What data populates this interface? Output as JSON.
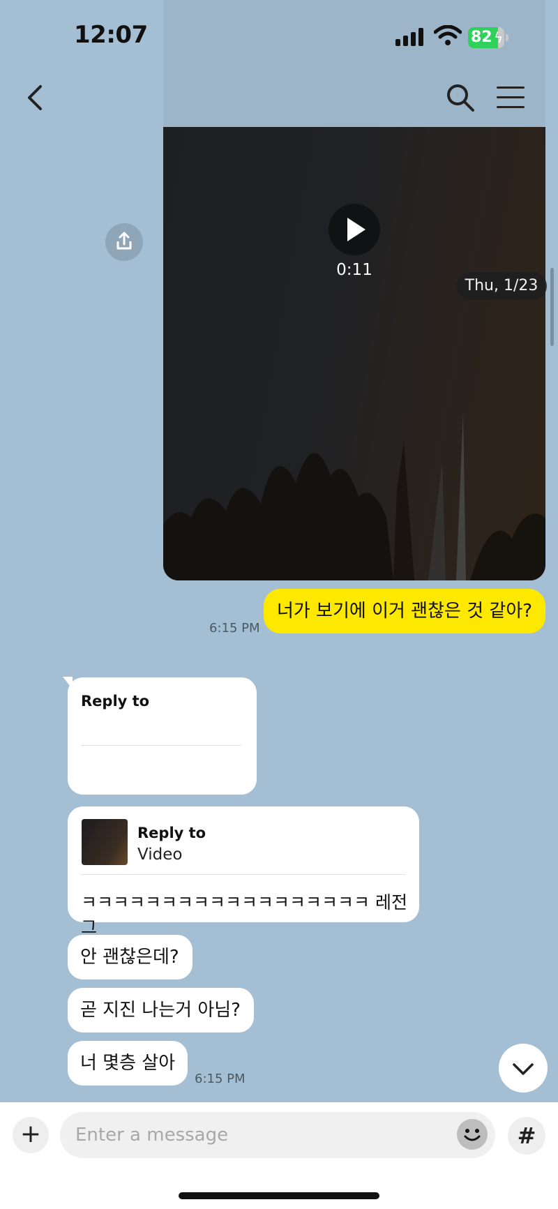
{
  "status_bar": {
    "time": "12:07",
    "battery_percent": "82",
    "battery_level": 0.82
  },
  "chat": {
    "video_message": {
      "duration": "0:11",
      "date_chip": "Thu, 1/23"
    },
    "outgoing": {
      "text": "너가 보기에 이거 괜찮은 것 같아?",
      "time": "6:15 PM"
    },
    "incoming": {
      "reply_card": {
        "label": "Reply to"
      },
      "video_reply": {
        "label": "Reply to",
        "subtitle": "Video",
        "text": "ㅋㅋㅋㅋㅋㅋㅋㅋㅋㅋㅋㅋㅋㅋㅋㅋㅋㅋ 레전그"
      },
      "messages": [
        {
          "text": "안 괜찮은데?"
        },
        {
          "text": "곧 지진 나는거 아님?"
        },
        {
          "text": "너 몇층 살아"
        }
      ],
      "time": "6:15 PM"
    }
  },
  "input_bar": {
    "placeholder": "Enter a message",
    "value": ""
  },
  "icons": [
    "back-icon",
    "search-icon",
    "menu-icon",
    "play-icon",
    "share-icon",
    "chevron-down-icon",
    "plus-icon",
    "emoji-icon",
    "hash-icon"
  ],
  "colors": {
    "background": "#a4bfd3",
    "outgoing_bubble": "#fde800",
    "incoming_bubble": "#ffffff",
    "battery_green": "#2fd15a"
  }
}
